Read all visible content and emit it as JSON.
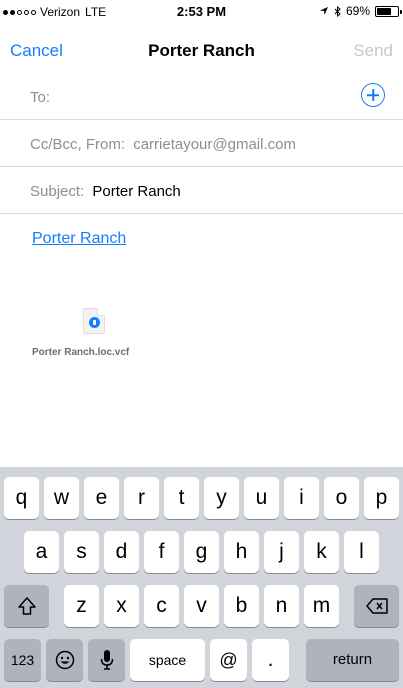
{
  "status_bar": {
    "carrier": "Verizon",
    "network": "LTE",
    "time": "2:53 PM",
    "battery_percent": "69%",
    "battery_level": 0.69,
    "signal_bars": 2
  },
  "nav": {
    "cancel_label": "Cancel",
    "title": "Porter Ranch",
    "send_label": "Send"
  },
  "fields": {
    "to_label": "To:",
    "ccbcc_label": "Cc/Bcc, From:",
    "from_value": "carrietayour@gmail.com",
    "subject_label": "Subject:",
    "subject_value": "Porter Ranch"
  },
  "body": {
    "link_text": "Porter Ranch"
  },
  "attachment": {
    "file_name": "Porter Ranch.loc.vcf",
    "icon": "location-pin-icon"
  },
  "keyboard": {
    "row1": [
      "q",
      "w",
      "e",
      "r",
      "t",
      "y",
      "u",
      "i",
      "o",
      "p"
    ],
    "row2": [
      "a",
      "s",
      "d",
      "f",
      "g",
      "h",
      "j",
      "k",
      "l"
    ],
    "row3": [
      "z",
      "x",
      "c",
      "v",
      "b",
      "n",
      "m"
    ],
    "shift_icon": "shift-icon",
    "delete_icon": "delete-icon",
    "numbers_label": "123",
    "emoji_icon": "emoji-icon",
    "mic_icon": "microphone-icon",
    "space_label": "space",
    "at_label": "@",
    "period_label": ".",
    "return_label": "return"
  },
  "colors": {
    "accent": "#147efb",
    "disabled": "#c7c7cc",
    "keyboard_bg": "#d1d5db"
  }
}
